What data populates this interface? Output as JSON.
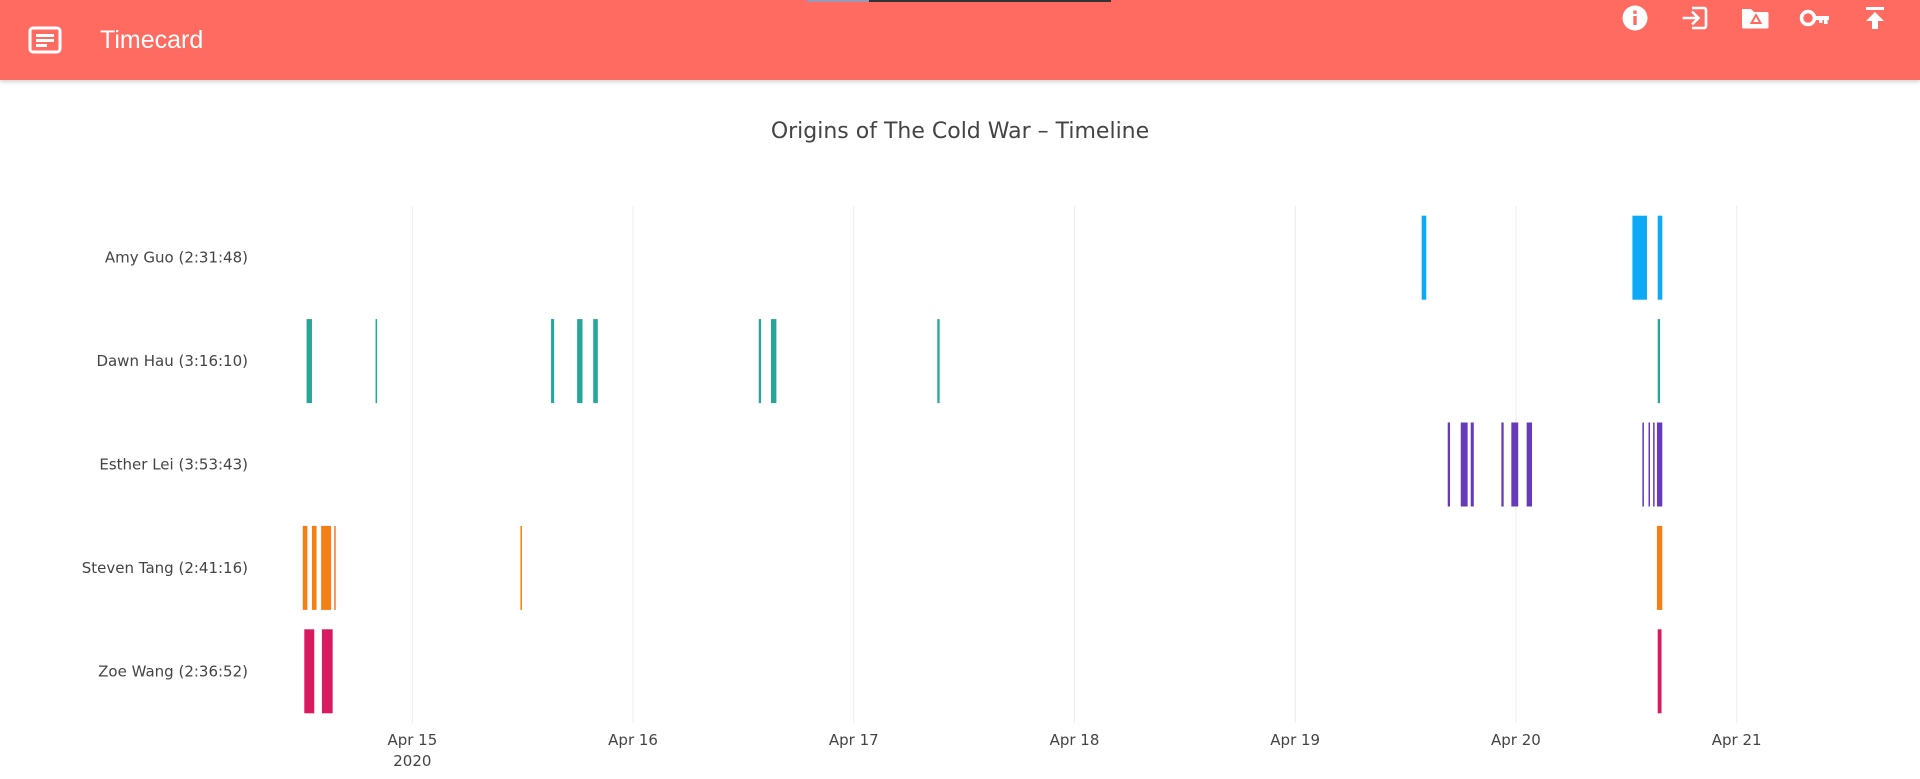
{
  "app": {
    "title": "Timecard",
    "bar_color": "#ff6b60",
    "menu_icon": "menu-icon",
    "actions": [
      {
        "name": "info-button",
        "icon": "info-icon"
      },
      {
        "name": "login-button",
        "icon": "login-icon"
      },
      {
        "name": "drive-folder-button",
        "icon": "drive-folder-icon"
      },
      {
        "name": "key-button",
        "icon": "key-icon"
      },
      {
        "name": "upload-button",
        "icon": "upload-icon"
      }
    ]
  },
  "chart_data": {
    "type": "timeline",
    "title": "Origins of The Cold War – Timeline",
    "x_axis": {
      "type": "date",
      "range": [
        "2020-04-14 12:00",
        "2020-04-21 12:00"
      ],
      "ticks": [
        {
          "value": "2020-04-15",
          "label": "Apr 15",
          "sublabel": "2020"
        },
        {
          "value": "2020-04-16",
          "label": "Apr 16"
        },
        {
          "value": "2020-04-17",
          "label": "Apr 17"
        },
        {
          "value": "2020-04-18",
          "label": "Apr 18"
        },
        {
          "value": "2020-04-19",
          "label": "Apr 19"
        },
        {
          "value": "2020-04-20",
          "label": "Apr 20"
        },
        {
          "value": "2020-04-21",
          "label": "Apr 21"
        }
      ],
      "grid": true
    },
    "series": [
      {
        "label": "Amy Guo (2:31:48)",
        "color": "#0da9f7",
        "segments": [
          [
            "2020-04-19 13:45",
            "2020-04-19 14:15"
          ],
          [
            "2020-04-20 12:40",
            "2020-04-20 14:15"
          ],
          [
            "2020-04-20 15:25",
            "2020-04-20 15:55"
          ]
        ]
      },
      {
        "label": "Dawn Hau (3:16:10)",
        "color": "#26a69a",
        "segments": [
          [
            "2020-04-14 12:30",
            "2020-04-14 13:05"
          ],
          [
            "2020-04-14 20:00",
            "2020-04-14 20:10"
          ],
          [
            "2020-04-15 15:05",
            "2020-04-15 15:25"
          ],
          [
            "2020-04-15 17:55",
            "2020-04-15 18:30"
          ],
          [
            "2020-04-15 19:40",
            "2020-04-15 20:10"
          ],
          [
            "2020-04-16 13:40",
            "2020-04-16 13:55"
          ],
          [
            "2020-04-16 15:00",
            "2020-04-16 15:35"
          ],
          [
            "2020-04-17 09:05",
            "2020-04-17 09:20"
          ],
          [
            "2020-04-20 15:25",
            "2020-04-20 15:40"
          ]
        ]
      },
      {
        "label": "Esther Lei (3:53:43)",
        "color": "#673ab7",
        "segments": [
          [
            "2020-04-19 16:35",
            "2020-04-19 16:50"
          ],
          [
            "2020-04-19 18:00",
            "2020-04-19 18:45"
          ],
          [
            "2020-04-19 19:05",
            "2020-04-19 19:25"
          ],
          [
            "2020-04-19 22:25",
            "2020-04-19 22:40"
          ],
          [
            "2020-04-19 23:30",
            "2020-04-20 00:15"
          ],
          [
            "2020-04-20 01:10",
            "2020-04-20 01:45"
          ],
          [
            "2020-04-20 13:45",
            "2020-04-20 13:55"
          ],
          [
            "2020-04-20 14:25",
            "2020-04-20 14:30"
          ],
          [
            "2020-04-20 14:55",
            "2020-04-20 15:00"
          ],
          [
            "2020-04-20 15:20",
            "2020-04-20 15:55"
          ]
        ]
      },
      {
        "label": "Steven Tang (2:41:16)",
        "color": "#f57f17",
        "segments": [
          [
            "2020-04-14 12:05",
            "2020-04-14 12:35"
          ],
          [
            "2020-04-14 13:05",
            "2020-04-14 13:35"
          ],
          [
            "2020-04-14 14:05",
            "2020-04-14 15:10"
          ],
          [
            "2020-04-14 15:30",
            "2020-04-14 15:40"
          ],
          [
            "2020-04-15 11:45",
            "2020-04-15 11:55"
          ],
          [
            "2020-04-20 15:20",
            "2020-04-20 15:55"
          ]
        ]
      },
      {
        "label": "Zoe Wang (2:36:52)",
        "color": "#d81b60",
        "segments": [
          [
            "2020-04-14 12:15",
            "2020-04-14 13:20"
          ],
          [
            "2020-04-14 14:10",
            "2020-04-14 15:20"
          ],
          [
            "2020-04-20 15:25",
            "2020-04-20 15:50"
          ]
        ]
      }
    ]
  }
}
